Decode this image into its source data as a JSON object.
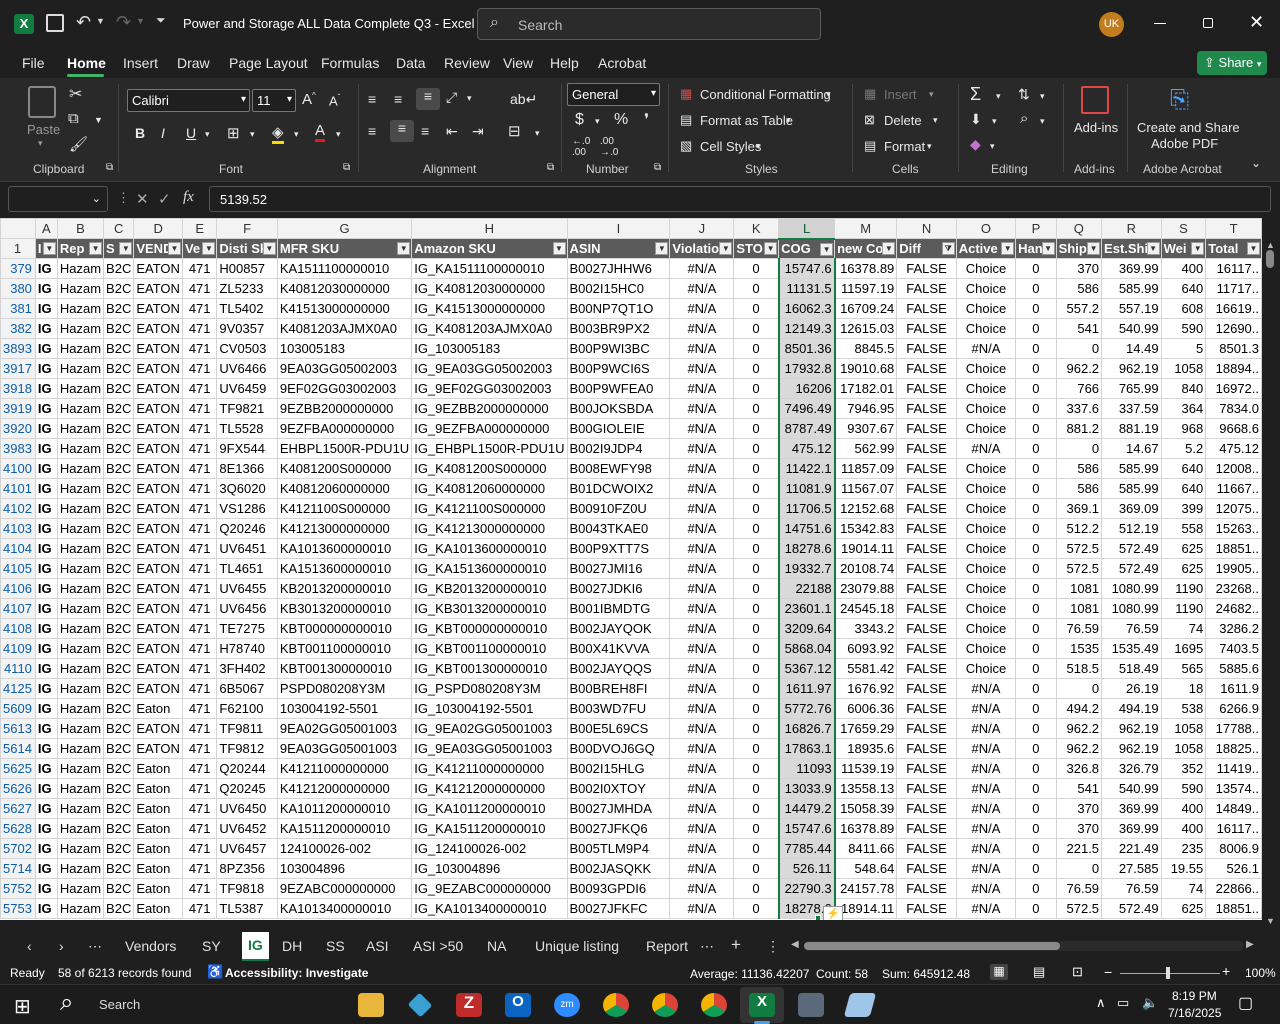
{
  "titlebar": {
    "doc_title": "Power and Storage ALL Data Complete Q3  -  Excel",
    "search_placeholder": "Search",
    "user_initials": "UK"
  },
  "menu": {
    "items": [
      "File",
      "Home",
      "Insert",
      "Draw",
      "Page Layout",
      "Formulas",
      "Data",
      "Review",
      "View",
      "Help",
      "Acrobat"
    ],
    "share": "Share"
  },
  "ribbon": {
    "paste": "Paste",
    "clipboard": "Clipboard",
    "font_name": "Calibri",
    "font_size": "11",
    "font": "Font",
    "alignment": "Alignment",
    "number_format": "General",
    "number": "Number",
    "cond_format": "Conditional Formatting",
    "format_table": "Format as Table",
    "cell_styles": "Cell Styles",
    "styles": "Styles",
    "insert": "Insert",
    "delete": "Delete",
    "format": "Format",
    "cells": "Cells",
    "editing": "Editing",
    "addins": "Add-ins",
    "addins_group": "Add-ins",
    "create_pdf_1": "Create and Share",
    "create_pdf_2": "Adobe PDF",
    "adobe": "Adobe Acrobat"
  },
  "formula_bar": {
    "name_box": "",
    "value": "5139.52"
  },
  "columns": [
    "A",
    "B",
    "C",
    "D",
    "E",
    "F",
    "G",
    "H",
    "I",
    "J",
    "K",
    "L",
    "M",
    "N",
    "O",
    "P",
    "Q",
    "R",
    "S",
    "T"
  ],
  "header_row": {
    "num": "1",
    "cells": [
      "I",
      "Rep",
      "S",
      "VEND",
      "Ve",
      "Disti Sk",
      "MFR SKU",
      "Amazon SKU",
      "ASIN",
      "Violatio",
      "STO",
      "COG",
      "new Co",
      "Diff",
      "Active",
      "Han",
      "Ship",
      "Est.Shi",
      "Wei",
      "Total"
    ]
  },
  "rows": [
    {
      "n": "379",
      "c": [
        "IG",
        "Hazam",
        "B2C",
        "EATON",
        "471",
        "H00857",
        "KA1511100000010",
        "IG_KA1511100000010",
        "B0027JHHW6",
        "#N/A",
        "0",
        "15747.6",
        "16378.89",
        "FALSE",
        "Choice",
        "0",
        "370",
        "369.99",
        "400",
        "16117.."
      ]
    },
    {
      "n": "380",
      "c": [
        "IG",
        "Hazam",
        "B2C",
        "EATON",
        "471",
        "ZL5233",
        "K40812030000000",
        "IG_K40812030000000",
        "B002I15HC0",
        "#N/A",
        "0",
        "11131.5",
        "11597.19",
        "FALSE",
        "Choice",
        "0",
        "586",
        "585.99",
        "640",
        "11717.."
      ]
    },
    {
      "n": "381",
      "c": [
        "IG",
        "Hazam",
        "B2C",
        "EATON",
        "471",
        "TL5402",
        "K41513000000000",
        "IG_K41513000000000",
        "B00NP7QT1O",
        "#N/A",
        "0",
        "16062.3",
        "16709.24",
        "FALSE",
        "Choice",
        "0",
        "557.2",
        "557.19",
        "608",
        "16619.."
      ]
    },
    {
      "n": "382",
      "c": [
        "IG",
        "Hazam",
        "B2C",
        "EATON",
        "471",
        "9V0357",
        "K4081203AJMX0A0",
        "IG_K4081203AJMX0A0",
        "B003BR9PX2",
        "#N/A",
        "0",
        "12149.3",
        "12615.03",
        "FALSE",
        "Choice",
        "0",
        "541",
        "540.99",
        "590",
        "12690.."
      ]
    },
    {
      "n": "3893",
      "c": [
        "IG",
        "Hazam",
        "B2C",
        "EATON",
        "471",
        "CV0503",
        "103005183",
        "IG_103005183",
        "B00P9WI3BC",
        "#N/A",
        "0",
        "8501.36",
        "8845.5",
        "FALSE",
        "#N/A",
        "0",
        "0",
        "14.49",
        "5",
        "8501.3"
      ]
    },
    {
      "n": "3917",
      "c": [
        "IG",
        "Hazam",
        "B2C",
        "EATON",
        "471",
        "UV6466",
        "9EA03GG05002003",
        "IG_9EA03GG05002003",
        "B00P9WCI6S",
        "#N/A",
        "0",
        "17932.8",
        "19010.68",
        "FALSE",
        "Choice",
        "0",
        "962.2",
        "962.19",
        "1058",
        "18894.."
      ]
    },
    {
      "n": "3918",
      "c": [
        "IG",
        "Hazam",
        "B2C",
        "EATON",
        "471",
        "UV6459",
        "9EF02GG03002003",
        "IG_9EF02GG03002003",
        "B00P9WFEA0",
        "#N/A",
        "0",
        "16206",
        "17182.01",
        "FALSE",
        "Choice",
        "0",
        "766",
        "765.99",
        "840",
        "16972.."
      ]
    },
    {
      "n": "3919",
      "c": [
        "IG",
        "Hazam",
        "B2C",
        "EATON",
        "471",
        "TF9821",
        "9EZBB2000000000",
        "IG_9EZBB2000000000",
        "B00JOKSBDA",
        "#N/A",
        "0",
        "7496.49",
        "7946.95",
        "FALSE",
        "Choice",
        "0",
        "337.6",
        "337.59",
        "364",
        "7834.0"
      ]
    },
    {
      "n": "3920",
      "c": [
        "IG",
        "Hazam",
        "B2C",
        "EATON",
        "471",
        "TL5528",
        "9EZFBA000000000",
        "IG_9EZFBA000000000",
        "B00GIOLEIE",
        "#N/A",
        "0",
        "8787.49",
        "9307.67",
        "FALSE",
        "Choice",
        "0",
        "881.2",
        "881.19",
        "968",
        "9668.6"
      ]
    },
    {
      "n": "3983",
      "c": [
        "IG",
        "Hazam",
        "B2C",
        "EATON",
        "471",
        "9FX544",
        "EHBPL1500R-PDU1U",
        "IG_EHBPL1500R-PDU1U",
        "B002I9JDP4",
        "#N/A",
        "0",
        "475.12",
        "562.99",
        "FALSE",
        "#N/A",
        "0",
        "0",
        "14.67",
        "5.2",
        "475.12"
      ]
    },
    {
      "n": "4100",
      "c": [
        "IG",
        "Hazam",
        "B2C",
        "EATON",
        "471",
        "8E1366",
        "K4081200S000000",
        "IG_K4081200S000000",
        "B008EWFY98",
        "#N/A",
        "0",
        "11422.1",
        "11857.09",
        "FALSE",
        "Choice",
        "0",
        "586",
        "585.99",
        "640",
        "12008.."
      ]
    },
    {
      "n": "4101",
      "c": [
        "IG",
        "Hazam",
        "B2C",
        "EATON",
        "471",
        "3Q6020",
        "K40812060000000",
        "IG_K40812060000000",
        "B01DCWOIX2",
        "#N/A",
        "0",
        "11081.9",
        "11567.07",
        "FALSE",
        "Choice",
        "0",
        "586",
        "585.99",
        "640",
        "11667.."
      ]
    },
    {
      "n": "4102",
      "c": [
        "IG",
        "Hazam",
        "B2C",
        "EATON",
        "471",
        "VS1286",
        "K4121100S000000",
        "IG_K4121100S000000",
        "B00910FZ0U",
        "#N/A",
        "0",
        "11706.5",
        "12152.68",
        "FALSE",
        "Choice",
        "0",
        "369.1",
        "369.09",
        "399",
        "12075.."
      ]
    },
    {
      "n": "4103",
      "c": [
        "IG",
        "Hazam",
        "B2C",
        "EATON",
        "471",
        "Q20246",
        "K41213000000000",
        "IG_K41213000000000",
        "B0043TKAE0",
        "#N/A",
        "0",
        "14751.6",
        "15342.83",
        "FALSE",
        "Choice",
        "0",
        "512.2",
        "512.19",
        "558",
        "15263.."
      ]
    },
    {
      "n": "4104",
      "c": [
        "IG",
        "Hazam",
        "B2C",
        "EATON",
        "471",
        "UV6451",
        "KA1013600000010",
        "IG_KA1013600000010",
        "B00P9XTT7S",
        "#N/A",
        "0",
        "18278.6",
        "19014.11",
        "FALSE",
        "Choice",
        "0",
        "572.5",
        "572.49",
        "625",
        "18851.."
      ]
    },
    {
      "n": "4105",
      "c": [
        "IG",
        "Hazam",
        "B2C",
        "EATON",
        "471",
        "TL4651",
        "KA1513600000010",
        "IG_KA1513600000010",
        "B0027JMI16",
        "#N/A",
        "0",
        "19332.7",
        "20108.74",
        "FALSE",
        "Choice",
        "0",
        "572.5",
        "572.49",
        "625",
        "19905.."
      ]
    },
    {
      "n": "4106",
      "c": [
        "IG",
        "Hazam",
        "B2C",
        "EATON",
        "471",
        "UV6455",
        "KB2013200000010",
        "IG_KB2013200000010",
        "B0027JDKI6",
        "#N/A",
        "0",
        "22188",
        "23079.88",
        "FALSE",
        "Choice",
        "0",
        "1081",
        "1080.99",
        "1190",
        "23268.."
      ]
    },
    {
      "n": "4107",
      "c": [
        "IG",
        "Hazam",
        "B2C",
        "EATON",
        "471",
        "UV6456",
        "KB3013200000010",
        "IG_KB3013200000010",
        "B001IBMDTG",
        "#N/A",
        "0",
        "23601.1",
        "24545.18",
        "FALSE",
        "Choice",
        "0",
        "1081",
        "1080.99",
        "1190",
        "24682.."
      ]
    },
    {
      "n": "4108",
      "c": [
        "IG",
        "Hazam",
        "B2C",
        "EATON",
        "471",
        "TE7275",
        "KBT000000000010",
        "IG_KBT000000000010",
        "B002JAYQOK",
        "#N/A",
        "0",
        "3209.64",
        "3343.2",
        "FALSE",
        "Choice",
        "0",
        "76.59",
        "76.59",
        "74",
        "3286.2"
      ]
    },
    {
      "n": "4109",
      "c": [
        "IG",
        "Hazam",
        "B2C",
        "EATON",
        "471",
        "H78740",
        "KBT001100000010",
        "IG_KBT001100000010",
        "B00X41KVVA",
        "#N/A",
        "0",
        "5868.04",
        "6093.92",
        "FALSE",
        "Choice",
        "0",
        "1535",
        "1535.49",
        "1695",
        "7403.5"
      ]
    },
    {
      "n": "4110",
      "c": [
        "IG",
        "Hazam",
        "B2C",
        "EATON",
        "471",
        "3FH402",
        "KBT001300000010",
        "IG_KBT001300000010",
        "B002JAYQQS",
        "#N/A",
        "0",
        "5367.12",
        "5581.42",
        "FALSE",
        "Choice",
        "0",
        "518.5",
        "518.49",
        "565",
        "5885.6"
      ]
    },
    {
      "n": "4125",
      "c": [
        "IG",
        "Hazam",
        "B2C",
        "EATON",
        "471",
        "6B5067",
        "PSPD080208Y3M",
        "IG_PSPD080208Y3M",
        "B00BREH8FI",
        "#N/A",
        "0",
        "1611.97",
        "1676.92",
        "FALSE",
        "#N/A",
        "0",
        "0",
        "26.19",
        "18",
        "1611.9"
      ]
    },
    {
      "n": "5609",
      "c": [
        "IG",
        "Hazam",
        "B2C",
        "Eaton",
        "471",
        "F62100",
        "103004192-5501",
        "IG_103004192-5501",
        "B003WD7FU",
        "#N/A",
        "0",
        "5772.76",
        "6006.36",
        "FALSE",
        "#N/A",
        "0",
        "494.2",
        "494.19",
        "538",
        "6266.9"
      ]
    },
    {
      "n": "5613",
      "c": [
        "IG",
        "Hazam",
        "B2C",
        "EATON",
        "471",
        "TF9811",
        "9EA02GG05001003",
        "IG_9EA02GG05001003",
        "B00E5L69CS",
        "#N/A",
        "0",
        "16826.7",
        "17659.29",
        "FALSE",
        "#N/A",
        "0",
        "962.2",
        "962.19",
        "1058",
        "17788.."
      ]
    },
    {
      "n": "5614",
      "c": [
        "IG",
        "Hazam",
        "B2C",
        "EATON",
        "471",
        "TF9812",
        "9EA03GG05001003",
        "IG_9EA03GG05001003",
        "B00DVOJ6GQ",
        "#N/A",
        "0",
        "17863.1",
        "18935.6",
        "FALSE",
        "#N/A",
        "0",
        "962.2",
        "962.19",
        "1058",
        "18825.."
      ]
    },
    {
      "n": "5625",
      "c": [
        "IG",
        "Hazam",
        "B2C",
        "Eaton",
        "471",
        "Q20244",
        "K41211000000000",
        "IG_K41211000000000",
        "B002I15HLG",
        "#N/A",
        "0",
        "11093",
        "11539.19",
        "FALSE",
        "#N/A",
        "0",
        "326.8",
        "326.79",
        "352",
        "11419.."
      ]
    },
    {
      "n": "5626",
      "c": [
        "IG",
        "Hazam",
        "B2C",
        "Eaton",
        "471",
        "Q20245",
        "K41212000000000",
        "IG_K41212000000000",
        "B002I0XTOY",
        "#N/A",
        "0",
        "13033.9",
        "13558.13",
        "FALSE",
        "#N/A",
        "0",
        "541",
        "540.99",
        "590",
        "13574.."
      ]
    },
    {
      "n": "5627",
      "c": [
        "IG",
        "Hazam",
        "B2C",
        "Eaton",
        "471",
        "UV6450",
        "KA1011200000010",
        "IG_KA1011200000010",
        "B0027JMHDA",
        "#N/A",
        "0",
        "14479.2",
        "15058.39",
        "FALSE",
        "#N/A",
        "0",
        "370",
        "369.99",
        "400",
        "14849.."
      ]
    },
    {
      "n": "5628",
      "c": [
        "IG",
        "Hazam",
        "B2C",
        "Eaton",
        "471",
        "UV6452",
        "KA1511200000010",
        "IG_KA1511200000010",
        "B0027JFKQ6",
        "#N/A",
        "0",
        "15747.6",
        "16378.89",
        "FALSE",
        "#N/A",
        "0",
        "370",
        "369.99",
        "400",
        "16117.."
      ]
    },
    {
      "n": "5702",
      "c": [
        "IG",
        "Hazam",
        "B2C",
        "Eaton",
        "471",
        "UV6457",
        "124100026-002",
        "IG_124100026-002",
        "B005TLM9P4",
        "#N/A",
        "0",
        "7785.44",
        "8411.66",
        "FALSE",
        "#N/A",
        "0",
        "221.5",
        "221.49",
        "235",
        "8006.9"
      ]
    },
    {
      "n": "5714",
      "c": [
        "IG",
        "Hazam",
        "B2C",
        "Eaton",
        "471",
        "8PZ356",
        "103004896",
        "IG_103004896",
        "B002JASQKK",
        "#N/A",
        "0",
        "526.11",
        "548.64",
        "FALSE",
        "#N/A",
        "0",
        "0",
        "27.585",
        "19.55",
        "526.1"
      ]
    },
    {
      "n": "5752",
      "c": [
        "IG",
        "Hazam",
        "B2C",
        "Eaton",
        "471",
        "TF9818",
        "9EZABC000000000",
        "IG_9EZABC000000000",
        "B0093GPDI6",
        "#N/A",
        "0",
        "22790.3",
        "24157.78",
        "FALSE",
        "#N/A",
        "0",
        "76.59",
        "76.59",
        "74",
        "22866.."
      ]
    },
    {
      "n": "5753",
      "c": [
        "IG",
        "Hazam",
        "B2C",
        "Eaton",
        "471",
        "TL5387",
        "KA1013400000010",
        "IG_KA1013400000010",
        "B0027JFKFC",
        "#N/A",
        "0",
        "18278.6",
        "18914.11",
        "FALSE",
        "#N/A",
        "0",
        "572.5",
        "572.49",
        "625",
        "18851.."
      ]
    }
  ],
  "sheet_tabs": [
    "Vendors",
    "SY",
    "IG",
    "DH",
    "SS",
    "ASI",
    "ASI >50",
    "NA",
    "Unique listing",
    "Report"
  ],
  "active_sheet": "IG",
  "status": {
    "ready": "Ready",
    "records": "58 of 6213 records found",
    "accessibility": "Accessibility: Investigate",
    "average": "Average: 11136.42207",
    "count": "Count: 58",
    "sum": "Sum: 645912.48",
    "zoom": "100%"
  },
  "taskbar": {
    "search": "Search",
    "time": "8:19 PM",
    "date": "7/16/2025"
  },
  "colors": {
    "accent": "#107c41",
    "share_bg": "#1f8a4c",
    "header_fill": "#5b5b5b"
  }
}
